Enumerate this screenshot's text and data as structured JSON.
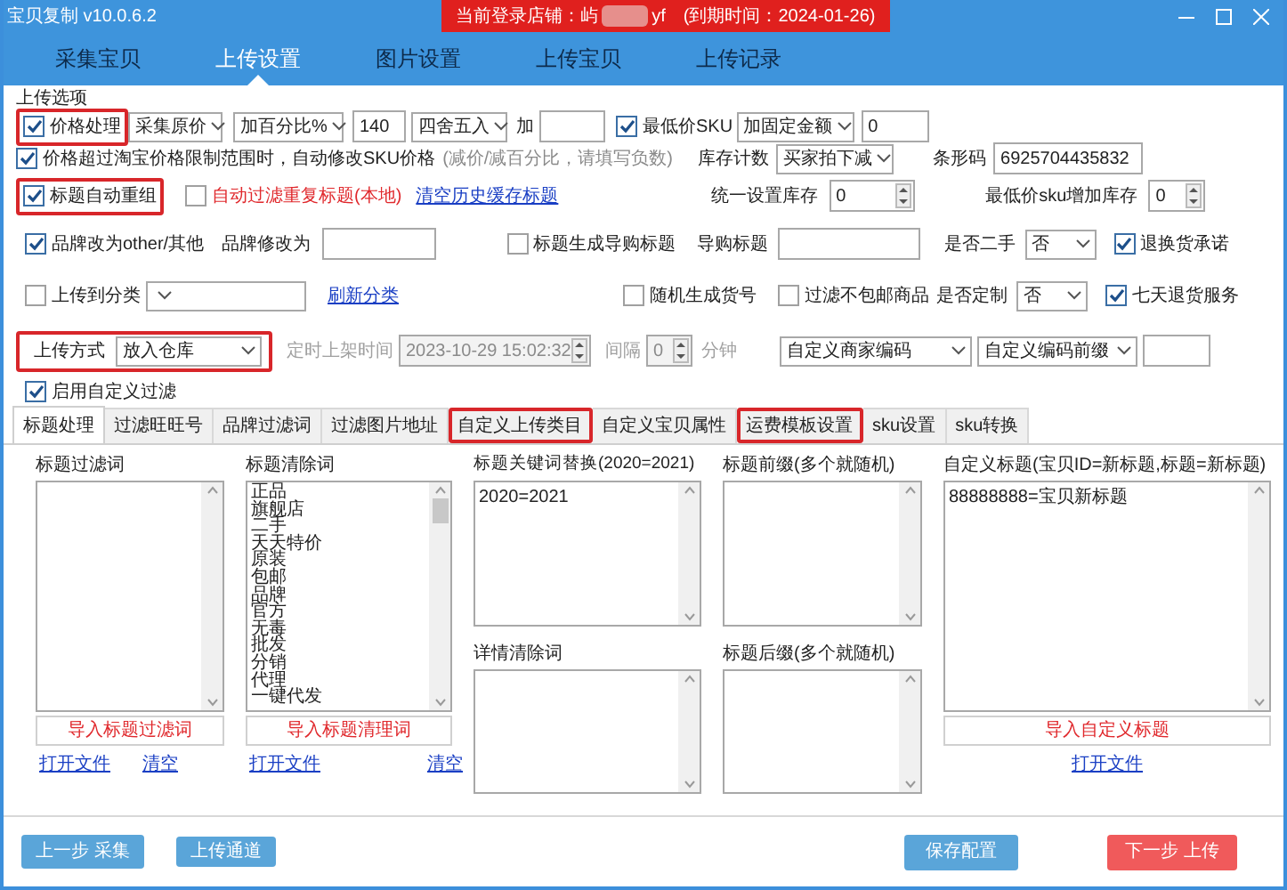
{
  "window": {
    "title": "宝贝复制 v10.0.6.2"
  },
  "login_banner": {
    "label": "当前登录店铺：屿",
    "store_suffix": "yf",
    "expiry": "(到期时间：2024-01-26)"
  },
  "nav_tabs": [
    {
      "label": "采集宝贝",
      "selected": false
    },
    {
      "label": "上传设置",
      "selected": true
    },
    {
      "label": "图片设置",
      "selected": false
    },
    {
      "label": "上传宝贝",
      "selected": false
    },
    {
      "label": "上传记录",
      "selected": false
    }
  ],
  "options": {
    "title": "上传选项",
    "lines": [
      {
        "controls": [
          {
            "kind": "checkbox",
            "label": "价格处理",
            "checked": true,
            "highlighted": true
          },
          {
            "kind": "select",
            "value": "采集原价"
          },
          {
            "kind": "select",
            "value": "加百分比%"
          },
          {
            "kind": "input",
            "value": "140"
          },
          {
            "kind": "select",
            "value": "四舍五入"
          },
          {
            "kind": "label",
            "text": "加"
          },
          {
            "kind": "input"
          },
          {
            "kind": "checkbox",
            "label": "最低价SKU",
            "checked": true
          },
          {
            "kind": "select",
            "value": "加固定金额"
          },
          {
            "kind": "input",
            "value": "0"
          }
        ]
      },
      {
        "controls": [
          {
            "kind": "checkbox",
            "label": "价格超过淘宝价格限制范围时，自动修改SKU价格",
            "checked": true
          },
          {
            "kind": "hint",
            "text": "(减价/减百分比，请填写负数)"
          },
          {
            "kind": "label",
            "text": "库存计数"
          },
          {
            "kind": "select",
            "value": "买家拍下减"
          },
          {
            "kind": "label",
            "text": "条形码"
          },
          {
            "kind": "input",
            "value": "6925704435832"
          }
        ]
      },
      {
        "controls": [
          {
            "kind": "checkbox",
            "label": "标题自动重组",
            "checked": true,
            "highlighted": true
          },
          {
            "kind": "checkbox",
            "label": "自动过滤重复标题(本地)",
            "checked": false,
            "warning": true
          },
          {
            "kind": "link",
            "text": "清空历史缓存标题"
          },
          {
            "kind": "label",
            "text": "统一设置库存"
          },
          {
            "kind": "spinner",
            "value": "0"
          },
          {
            "kind": "label",
            "text": "最低价sku增加库存"
          },
          {
            "kind": "spinner",
            "value": "0"
          }
        ]
      },
      {
        "controls": [
          {
            "kind": "checkbox",
            "label": "品牌改为other/其他",
            "checked": true
          },
          {
            "kind": "label",
            "text": "品牌修改为"
          },
          {
            "kind": "input"
          },
          {
            "kind": "checkbox",
            "label": "标题生成导购标题",
            "checked": false
          },
          {
            "kind": "label",
            "text": "导购标题"
          },
          {
            "kind": "input"
          },
          {
            "kind": "label",
            "text": "是否二手"
          },
          {
            "kind": "select",
            "value": "否"
          },
          {
            "kind": "checkbox",
            "label": "退换货承诺",
            "checked": true
          }
        ]
      },
      {
        "controls": [
          {
            "kind": "checkbox",
            "label": "上传到分类",
            "checked": false
          },
          {
            "kind": "select"
          },
          {
            "kind": "link",
            "text": "刷新分类"
          },
          {
            "kind": "checkbox",
            "label": "随机生成货号",
            "checked": false
          },
          {
            "kind": "checkbox",
            "label": "过滤不包邮商品",
            "checked": false
          },
          {
            "kind": "label",
            "text": "是否定制"
          },
          {
            "kind": "select",
            "value": "否"
          },
          {
            "kind": "checkbox",
            "label": "七天退货服务",
            "checked": true
          }
        ]
      },
      {
        "controls": [
          {
            "kind": "labeled_select",
            "label": "上传方式",
            "value": "放入仓库",
            "highlighted": true
          },
          {
            "kind": "label",
            "text": "定时上架时间",
            "disabled": true
          },
          {
            "kind": "spinner",
            "value": "2023-10-29 15:02:32",
            "disabled": true
          },
          {
            "kind": "label",
            "text": "间隔",
            "disabled": true
          },
          {
            "kind": "spinner",
            "value": "0",
            "disabled": true
          },
          {
            "kind": "label",
            "text": "分钟",
            "disabled": true
          },
          {
            "kind": "select",
            "value": "自定义商家编码"
          },
          {
            "kind": "select",
            "value": "自定义编码前缀"
          },
          {
            "kind": "input"
          }
        ]
      },
      {
        "controls": [
          {
            "kind": "checkbox",
            "label": "启用自定义过滤",
            "checked": true
          }
        ]
      }
    ]
  },
  "filter_tabs": [
    {
      "label": "标题处理",
      "selected": true,
      "highlighted": false
    },
    {
      "label": "过滤旺旺号",
      "selected": false,
      "highlighted": false
    },
    {
      "label": "品牌过滤词",
      "selected": false,
      "highlighted": false
    },
    {
      "label": "过滤图片地址",
      "selected": false,
      "highlighted": false
    },
    {
      "label": "自定义上传类目",
      "selected": false,
      "highlighted": true
    },
    {
      "label": "自定义宝贝属性",
      "selected": false,
      "highlighted": false
    },
    {
      "label": "运费模板设置",
      "selected": false,
      "highlighted": true
    },
    {
      "label": "sku设置",
      "selected": false,
      "highlighted": false
    },
    {
      "label": "sku转换",
      "selected": false,
      "highlighted": false
    }
  ],
  "title_panel": {
    "filter_words": {
      "label": "标题过滤词",
      "import_button": "导入标题过滤词",
      "links": [
        "打开文件",
        "清空"
      ]
    },
    "clean_words": {
      "label": "标题清除词",
      "lines": [
        "正品",
        "旗舰店",
        "二手",
        "天天特价",
        "原装",
        "包邮",
        "品牌",
        "官方",
        "无毒",
        "批发",
        "分销",
        "代理",
        "一键代发"
      ],
      "import_button": "导入标题清理词",
      "links": [
        "打开文件",
        "清空"
      ]
    },
    "keyword_replace": {
      "label": "标题关键词替换(2020=2021)",
      "value": "2020=2021"
    },
    "detail_clean": {
      "label": "详情清除词"
    },
    "prefix": {
      "label": "标题前缀(多个就随机)"
    },
    "suffix": {
      "label": "标题后缀(多个就随机)"
    },
    "custom_title": {
      "label": "自定义标题(宝贝ID=新标题,标题=新标题)",
      "value": "88888888=宝贝新标题",
      "import_button": "导入自定义标题",
      "links": [
        "打开文件"
      ]
    }
  },
  "footer_buttons": [
    {
      "label": "上一步 采集",
      "kind": "primary"
    },
    {
      "label": "上传通道",
      "kind": "primary"
    },
    {
      "label": "保存配置",
      "kind": "primary"
    },
    {
      "label": "下一步 上传",
      "kind": "danger"
    }
  ]
}
